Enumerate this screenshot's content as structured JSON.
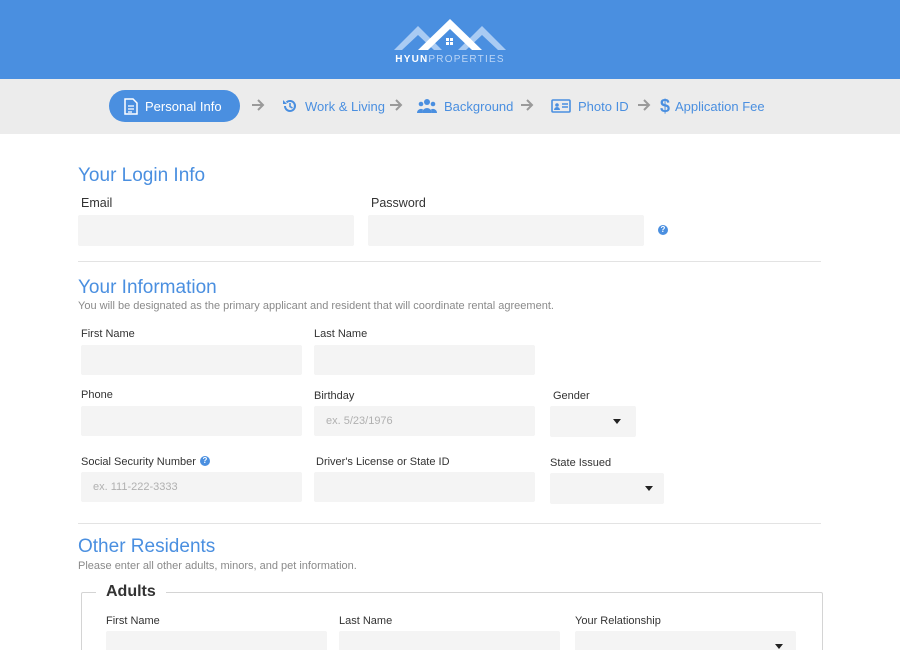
{
  "brand": {
    "name_bold": "HYUN",
    "name_light": "PROPERTIES",
    "logo_icon": "house-roofs-logo",
    "color_primary": "#4a8fe0"
  },
  "steps": [
    {
      "label": "Personal Info",
      "icon": "document-icon",
      "active": true
    },
    {
      "label": "Work & Living",
      "icon": "history-icon",
      "active": false
    },
    {
      "label": "Background",
      "icon": "users-icon",
      "active": false
    },
    {
      "label": "Photo ID",
      "icon": "id-card-icon",
      "active": false
    },
    {
      "label": "Application Fee",
      "icon": "dollar-icon",
      "active": false
    }
  ],
  "login": {
    "title": "Your Login Info",
    "email_label": "Email",
    "email_value": "",
    "password_label": "Password",
    "password_value": "",
    "help_icon": "question-circle-icon",
    "help_glyph": "?"
  },
  "info": {
    "title": "Your Information",
    "subtitle": "You will be designated as the primary applicant and resident that will coordinate rental agreement.",
    "first_name_label": "First Name",
    "first_name_value": "",
    "last_name_label": "Last Name",
    "last_name_value": "",
    "phone_label": "Phone",
    "phone_value": "",
    "birthday_label": "Birthday",
    "birthday_placeholder": "ex. 5/23/1976",
    "gender_label": "Gender",
    "gender_value": "",
    "ssn_label": "Social Security Number",
    "ssn_placeholder": "ex. 111-222-3333",
    "ssn_help_glyph": "?",
    "license_label": "Driver's License or State ID",
    "license_value": "",
    "state_label": "State Issued",
    "state_value": ""
  },
  "others": {
    "title": "Other Residents",
    "subtitle": "Please enter all other adults, minors, and pet information.",
    "adults_legend": "Adults",
    "first_name_label": "First Name",
    "last_name_label": "Last Name",
    "relationship_label": "Your Relationship"
  }
}
